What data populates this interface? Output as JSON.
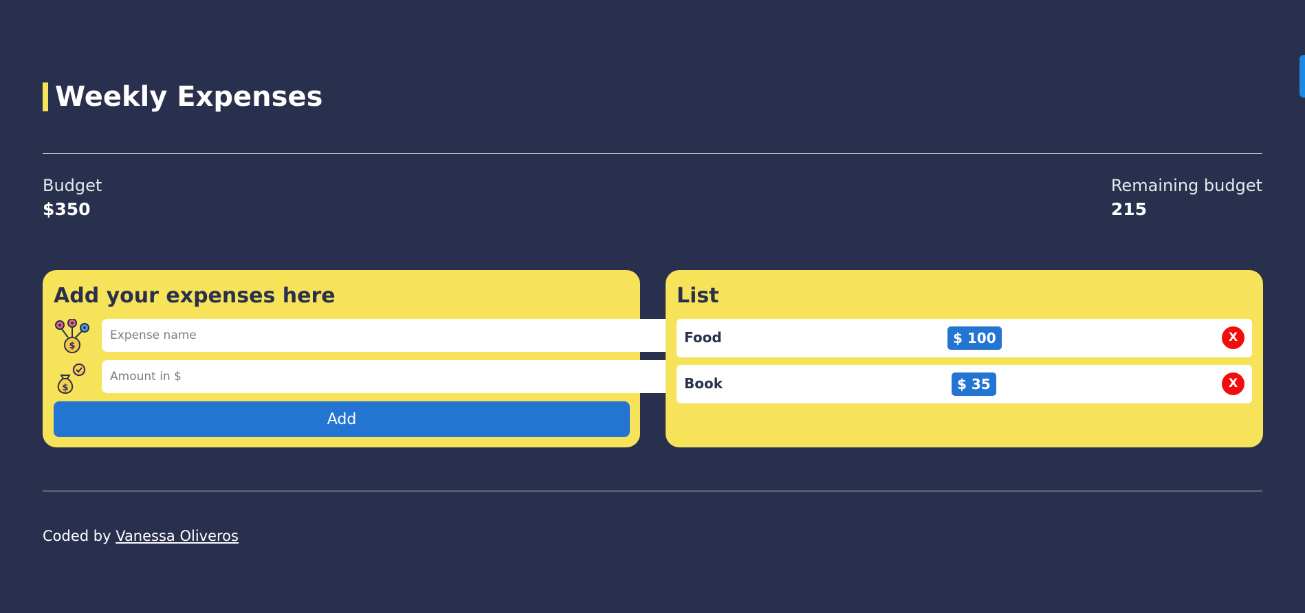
{
  "header": {
    "title": "Weekly Expenses"
  },
  "budget": {
    "label": "Budget",
    "value": "$350"
  },
  "remaining": {
    "label": "Remaining budget",
    "value": "215"
  },
  "form": {
    "title": "Add your expenses here",
    "name_placeholder": "Expense name",
    "amount_placeholder": "Amount in $",
    "add_label": "Add",
    "name_icon": "coins-target-icon",
    "amount_icon": "money-bag-check-icon"
  },
  "list": {
    "title": "List",
    "items": [
      {
        "name": "Food",
        "amount": "$ 100",
        "delete_label": "X"
      },
      {
        "name": "Book",
        "amount": "$ 35",
        "delete_label": "X"
      }
    ]
  },
  "footer": {
    "prefix": "Coded by ",
    "author": "Vanessa Oliveros"
  },
  "colors": {
    "background": "#29304d",
    "card": "#f6e35a",
    "accent": "#2474d2",
    "danger": "#f20d0d"
  }
}
